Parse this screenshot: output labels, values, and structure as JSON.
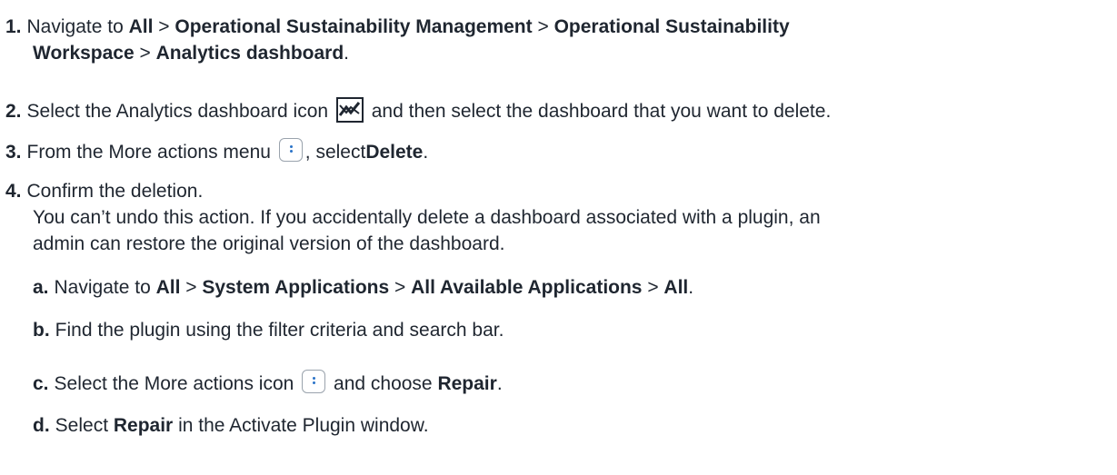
{
  "steps": [
    {
      "num": "1.",
      "pre": "Navigate to ",
      "p1": "All",
      "s1": " > ",
      "p2": "Operational Sustainability Management",
      "s2": " > ",
      "p3": "Operational Sustainability",
      "p4": "Workspace",
      "s3": " > ",
      "p5": "Analytics dashboard",
      "end": "."
    },
    {
      "num": "2.",
      "pre": "Select the Analytics dashboard icon",
      "post": "and then select the dashboard that you want to delete.",
      "icon": "analytics-dashboard-icon"
    },
    {
      "num": "3.",
      "pre": "From the More actions menu",
      "mid": ", select",
      "bold": "Delete",
      "end": ".",
      "icon": "more-actions-icon"
    },
    {
      "num": "4.",
      "text": "Confirm the deletion.",
      "note1": "You can’t undo this action. If you accidentally delete a dashboard associated with a plugin, an",
      "note2": "admin can restore the original version of the dashboard."
    }
  ],
  "substeps": [
    {
      "num": "a.",
      "pre": "Navigate to ",
      "p1": "All",
      "s1": " > ",
      "p2": "System Applications",
      "s2": " > ",
      "p3": "All Available Applications",
      "s3": " > ",
      "p4": "All",
      "end": "."
    },
    {
      "num": "b.",
      "text": "Find the plugin using the filter criteria and search bar."
    },
    {
      "num": "c.",
      "pre": "Select the More actions icon",
      "post": "and choose ",
      "bold": "Repair",
      "end": ".",
      "icon": "more-actions-icon"
    },
    {
      "num": "d.",
      "pre": "Select ",
      "bold": "Repair",
      "post": " in the Activate Plugin window."
    }
  ],
  "colors": {
    "text": "#1f2630",
    "icon_accent": "#2a73c8",
    "icon_border": "#1f2630"
  }
}
